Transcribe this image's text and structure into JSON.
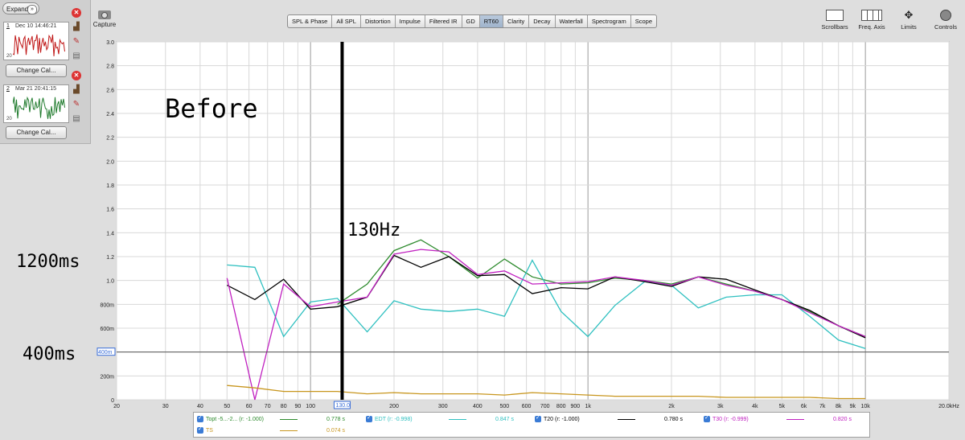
{
  "sidebar": {
    "expand_label": "Expand",
    "measurements": [
      {
        "number": "1",
        "date": "Dec 10 14:46:21",
        "min_label": "20",
        "color": "#c01818"
      },
      {
        "number": "2",
        "date": "Mar 21 20:41:15",
        "min_label": "20",
        "color": "#1f7a2c"
      }
    ],
    "change_cal_label": "Change Cal..."
  },
  "toolbar": {
    "capture_label": "Capture",
    "tabs": [
      "SPL & Phase",
      "All SPL",
      "Distortion",
      "Impulse",
      "Filtered IR",
      "GD",
      "RT60",
      "Clarity",
      "Decay",
      "Waterfall",
      "Spectrogram",
      "Scope"
    ],
    "active_tab": "RT60",
    "right_tools": [
      "Scrollbars",
      "Freq. Axis",
      "Limits",
      "Controls"
    ]
  },
  "annotations": {
    "before": "Before",
    "freq_marker": "130Hz",
    "level_high": "1200ms",
    "level_low": "400ms",
    "cursor_readout": "130.0",
    "hline_readout": "400m"
  },
  "legend": {
    "items": [
      {
        "name": "Topt -5...-2... (r: -1.000)",
        "value": "0.778 s",
        "color": "#2e8b2e"
      },
      {
        "name": "EDT (r: -0.998)",
        "value": "0.847 s",
        "color": "#2fc0c0"
      },
      {
        "name": "T20 (r: -1.000)",
        "value": "0.780 s",
        "color": "#000000"
      },
      {
        "name": "T30 (r: -0.999)",
        "value": "0.820 s",
        "color": "#c020c0"
      },
      {
        "name": "TS",
        "value": "0.074 s",
        "color": "#c8961e"
      }
    ]
  },
  "chart_data": {
    "type": "line",
    "x_scale": "log",
    "xlim": [
      20,
      20000
    ],
    "ylim": [
      0,
      3.0
    ],
    "x_ticks": [
      "20",
      "30",
      "40",
      "50",
      "60",
      "70",
      "80",
      "90",
      "100",
      "200",
      "300",
      "400",
      "500",
      "600",
      "700",
      "800",
      "900",
      "1k",
      "2k",
      "3k",
      "4k",
      "5k",
      "6k",
      "7k",
      "8k",
      "9k",
      "10k",
      "20.0kHz"
    ],
    "y_ticks": [
      "3.0",
      "2.8",
      "2.6",
      "2.4",
      "2.2",
      "2.0",
      "1.8",
      "1.6",
      "1.4",
      "1.2",
      "1.0",
      "800m",
      "600m",
      "400m",
      "200m",
      "0"
    ],
    "x": [
      50,
      63,
      80,
      100,
      125,
      160,
      200,
      250,
      315,
      400,
      500,
      630,
      800,
      1000,
      1250,
      1600,
      2000,
      2500,
      3150,
      4000,
      5000,
      6300,
      8000,
      10000
    ],
    "series": [
      {
        "name": "Topt",
        "color": "#2e8b2e",
        "values": [
          null,
          null,
          null,
          null,
          0.8,
          0.97,
          1.25,
          1.34,
          1.2,
          1.02,
          1.18,
          1.03,
          0.97,
          0.98,
          1.02,
          1.0,
          0.97,
          1.03,
          0.97,
          0.91,
          0.84,
          0.74,
          0.62,
          0.53
        ]
      },
      {
        "name": "EDT",
        "color": "#2fc0c0",
        "values": [
          1.13,
          1.11,
          0.53,
          0.82,
          0.85,
          0.57,
          0.83,
          0.76,
          0.74,
          0.76,
          0.7,
          1.17,
          0.74,
          0.53,
          0.79,
          0.99,
          0.96,
          0.77,
          0.86,
          0.88,
          0.88,
          0.7,
          0.5,
          0.43
        ]
      },
      {
        "name": "T20",
        "color": "#000000",
        "values": [
          0.96,
          0.84,
          1.01,
          0.76,
          0.78,
          0.86,
          1.21,
          1.11,
          1.2,
          1.04,
          1.05,
          0.89,
          0.94,
          0.93,
          1.03,
          0.99,
          0.95,
          1.03,
          1.01,
          0.92,
          0.84,
          0.75,
          0.62,
          0.52
        ]
      },
      {
        "name": "T30",
        "color": "#c020c0",
        "values": [
          1.02,
          0.0,
          0.97,
          0.78,
          0.82,
          0.86,
          1.22,
          1.26,
          1.24,
          1.05,
          1.08,
          0.97,
          0.98,
          0.99,
          1.03,
          1.0,
          0.96,
          1.03,
          0.96,
          0.91,
          0.84,
          0.73,
          0.62,
          0.53
        ]
      },
      {
        "name": "TS",
        "color": "#c8961e",
        "values": [
          0.12,
          0.1,
          0.07,
          0.07,
          0.07,
          0.05,
          0.06,
          0.05,
          0.05,
          0.05,
          0.04,
          0.06,
          0.05,
          0.04,
          0.03,
          0.03,
          0.03,
          0.03,
          0.02,
          0.02,
          0.02,
          0.02,
          0.01,
          0.01
        ]
      }
    ],
    "cursor_freq": 130,
    "hline": 0.4,
    "grid": true
  }
}
